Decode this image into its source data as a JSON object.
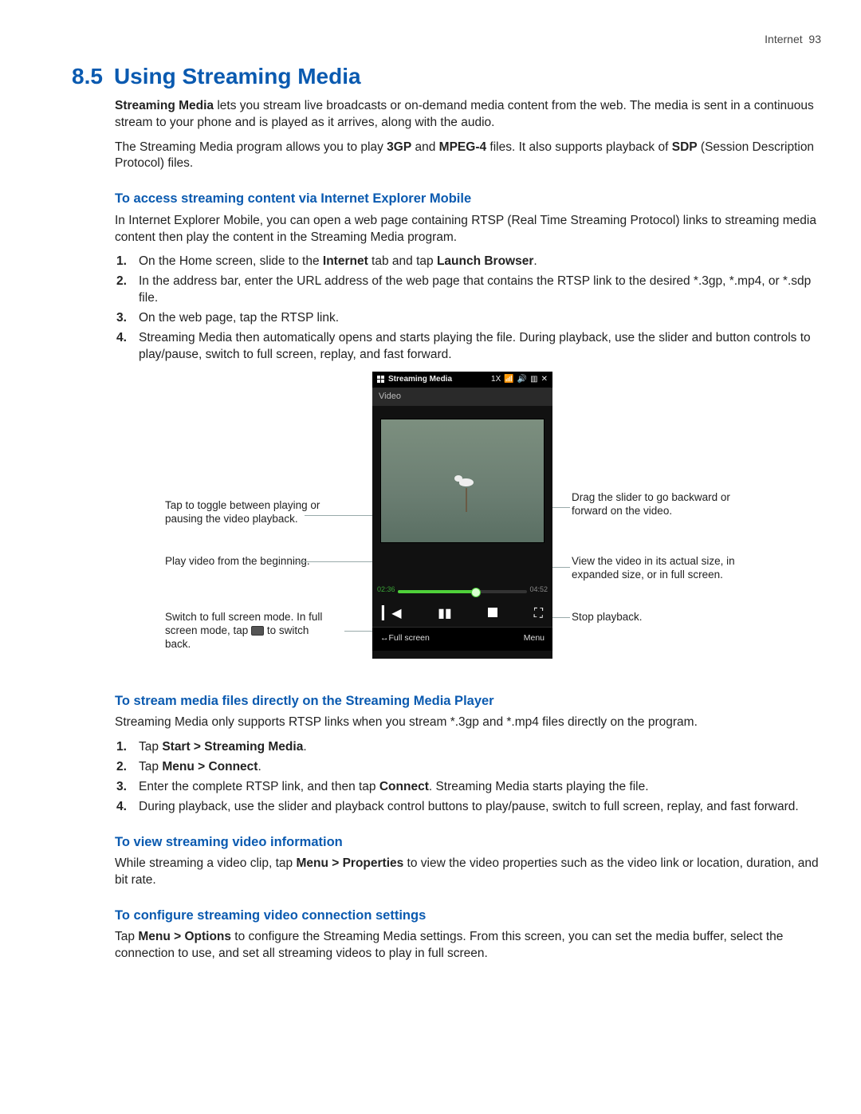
{
  "runhead": {
    "chapter": "Internet",
    "page": "93"
  },
  "title": {
    "number": "8.5",
    "text": "Using Streaming Media"
  },
  "intro": {
    "p1_a": "Streaming Media",
    "p1_b": " lets you stream live broadcasts or on-demand media content from the web. The media is sent in a continuous stream to your phone and is played as it arrives, along with the audio.",
    "p2_a": "The Streaming Media program allows you to play ",
    "p2_b": "3GP",
    "p2_c": " and ",
    "p2_d": "MPEG-4",
    "p2_e": " files. It also supports playback of ",
    "p2_f": "SDP",
    "p2_g": " (Session Description Protocol) files."
  },
  "secA": {
    "h": "To access streaming content via Internet Explorer Mobile",
    "p": "In Internet Explorer Mobile, you can open a web page containing RTSP (Real Time Streaming Protocol) links to streaming media content then play the content in the Streaming Media program.",
    "s1_a": "On the Home screen, slide to the ",
    "s1_b": "Internet",
    "s1_c": " tab and tap ",
    "s1_d": "Launch Browser",
    "s1_e": ".",
    "s2": "In the address bar, enter the URL address of the web page that contains the RTSP link to the desired *.3gp, *.mp4, or *.sdp file.",
    "s3": "On the web page, tap the RTSP link.",
    "s4": "Streaming Media then automatically opens and starts playing the file. During playback, use the slider and button controls to play/pause, switch to full screen, replay, and fast forward."
  },
  "phone": {
    "app_title": "Streaming Media",
    "status_1x": "1X",
    "video_label": "Video",
    "time_elapsed": "02:36",
    "time_total": "04:52",
    "soft_left": "↔Full screen",
    "soft_right": "Menu"
  },
  "callouts": {
    "L1": "Tap to toggle between playing or pausing the video playback.",
    "L2": "Play video from the beginning.",
    "L3a": "Switch to full screen mode. In full screen mode, tap ",
    "L3b": " to switch back.",
    "R1": "Drag the slider to go backward or forward on the video.",
    "R2": "View the video in its actual size, in expanded size, or in full screen.",
    "R3": "Stop playback."
  },
  "secB": {
    "h": "To stream media files directly on the Streaming Media Player",
    "p": "Streaming Media only supports RTSP links when you stream *.3gp and *.mp4 files directly on the program.",
    "s1_a": "Tap ",
    "s1_b": "Start > Streaming Media",
    "s1_c": ".",
    "s2_a": "Tap ",
    "s2_b": "Menu > Connect",
    "s2_c": ".",
    "s3_a": "Enter the complete RTSP link, and then tap ",
    "s3_b": "Connect",
    "s3_c": ". Streaming Media starts playing the file.",
    "s4": "During playback, use the slider and playback control buttons to play/pause, switch to full screen, replay, and fast forward."
  },
  "secC": {
    "h": "To view streaming video information",
    "p_a": "While streaming a video clip, tap ",
    "p_b": "Menu > Properties",
    "p_c": " to view the video properties such as the video link or location, duration, and bit rate."
  },
  "secD": {
    "h": "To configure streaming video connection settings",
    "p_a": "Tap ",
    "p_b": "Menu > Options",
    "p_c": " to configure the Streaming Media settings. From this screen, you can set the media buffer, select the connection to use, and set all streaming videos to play in full screen."
  }
}
